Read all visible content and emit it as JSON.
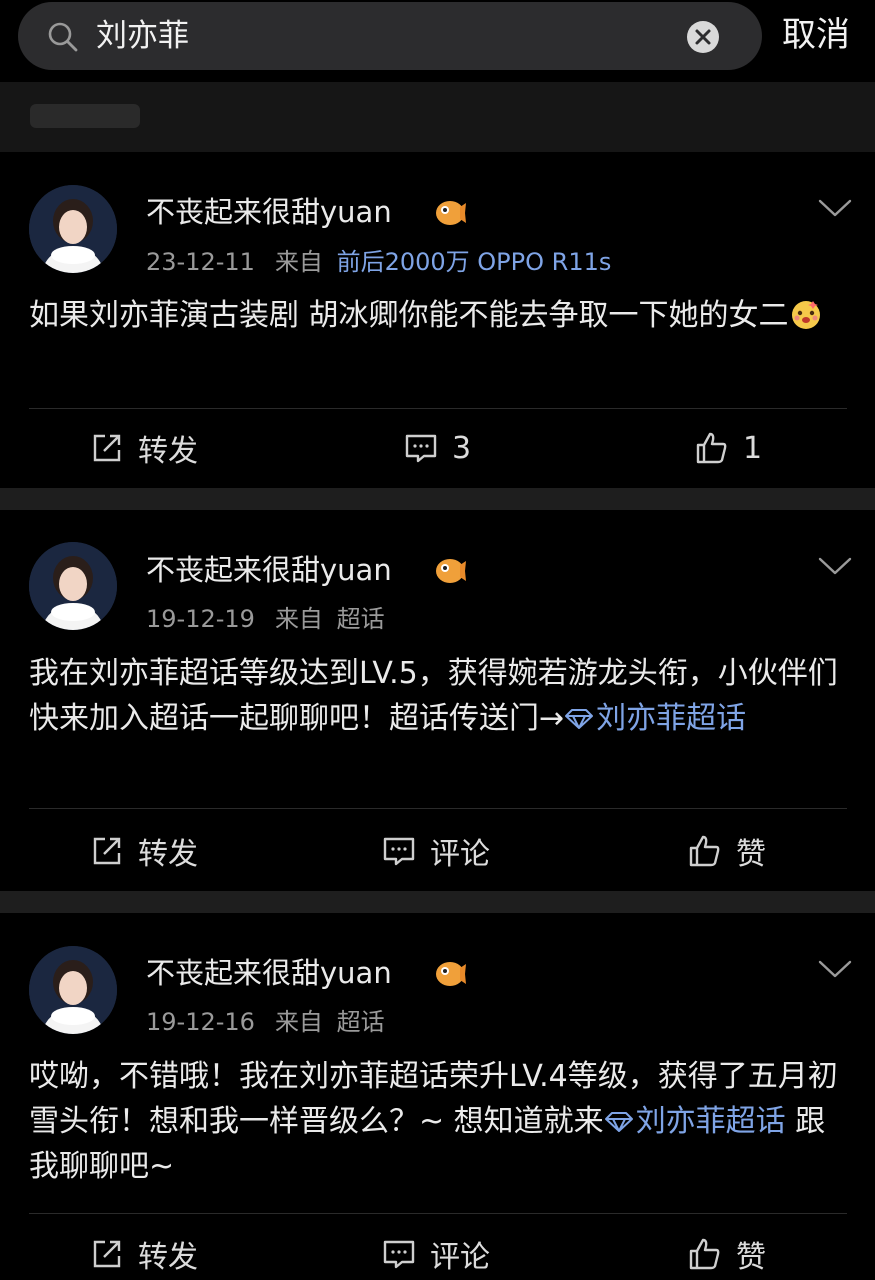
{
  "search": {
    "query": "刘亦菲",
    "cancel_label": "取消"
  },
  "posts": [
    {
      "username": "不丧起来很甜yuan",
      "date": "23-12-11",
      "from_label": "来自",
      "source": "前后2000万 OPPO R11s",
      "content": "如果刘亦菲演古装剧 胡冰卿你能不能去争取一下她的女二",
      "repost_label": "转发",
      "comment_label": "3",
      "like_label": "1"
    },
    {
      "username": "不丧起来很甜yuan",
      "date": "19-12-19",
      "from_label": "来自",
      "source": "超话",
      "content": "我在刘亦菲超话等级达到LV.5，获得婉若游龙头衔，小伙伴们快来加入超话一起聊聊吧！超话传送门→",
      "link": "刘亦菲超话",
      "repost_label": "转发",
      "comment_label": "评论",
      "like_label": "赞"
    },
    {
      "username": "不丧起来很甜yuan",
      "date": "19-12-16",
      "from_label": "来自",
      "source": "超话",
      "content": "哎呦，不错哦！我在刘亦菲超话荣升LV.4等级，获得了五月初雪头衔！想和我一样晋级么？~ 想知道就来",
      "link": "刘亦菲超话",
      "content_tail": " 跟我聊聊吧~",
      "repost_label": "转发",
      "comment_label": "评论",
      "like_label": "赞"
    }
  ]
}
